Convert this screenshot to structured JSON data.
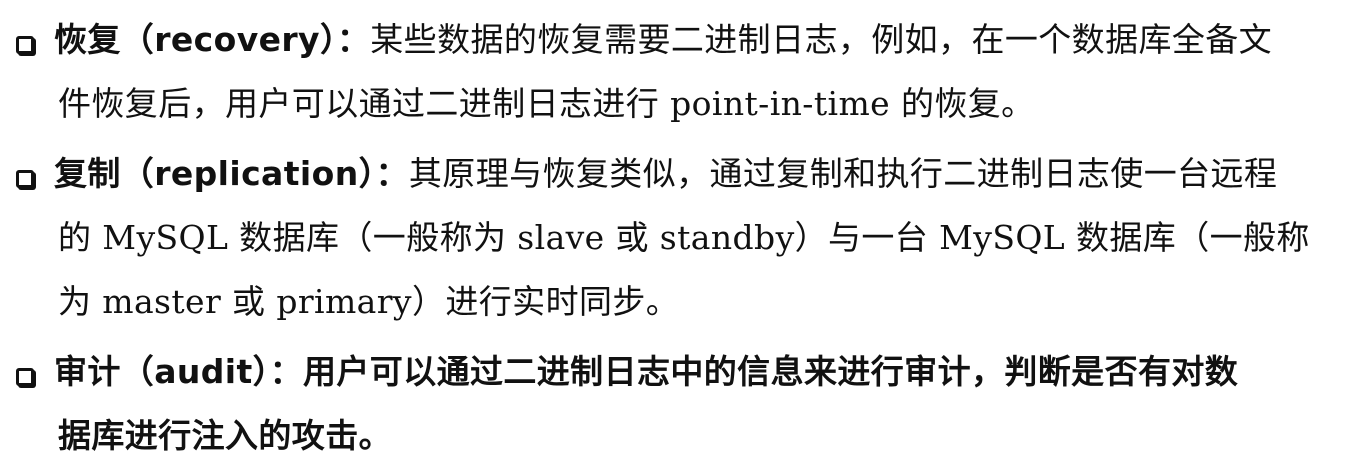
{
  "items": [
    {
      "term": "恢复（recovery）：",
      "lines": [
        "某些数据的恢复需要二进制日志，例如，在一个数据库全备文",
        "件恢复后，用户可以通过二进制日志进行 point-in-time 的恢复。"
      ]
    },
    {
      "term": "复制（replication）：",
      "lines": [
        "其原理与恢复类似，通过复制和执行二进制日志使一台远程",
        "的 MySQL 数据库（一般称为 slave 或 standby）与一台 MySQL 数据库（一般称",
        "为 master 或 primary）进行实时同步。"
      ]
    },
    {
      "term": "审计（audit）：",
      "lines": [
        "用户可以通过二进制日志中的信息来进行审计，判断是否有对数",
        "据库进行注入的攻击。"
      ]
    }
  ]
}
